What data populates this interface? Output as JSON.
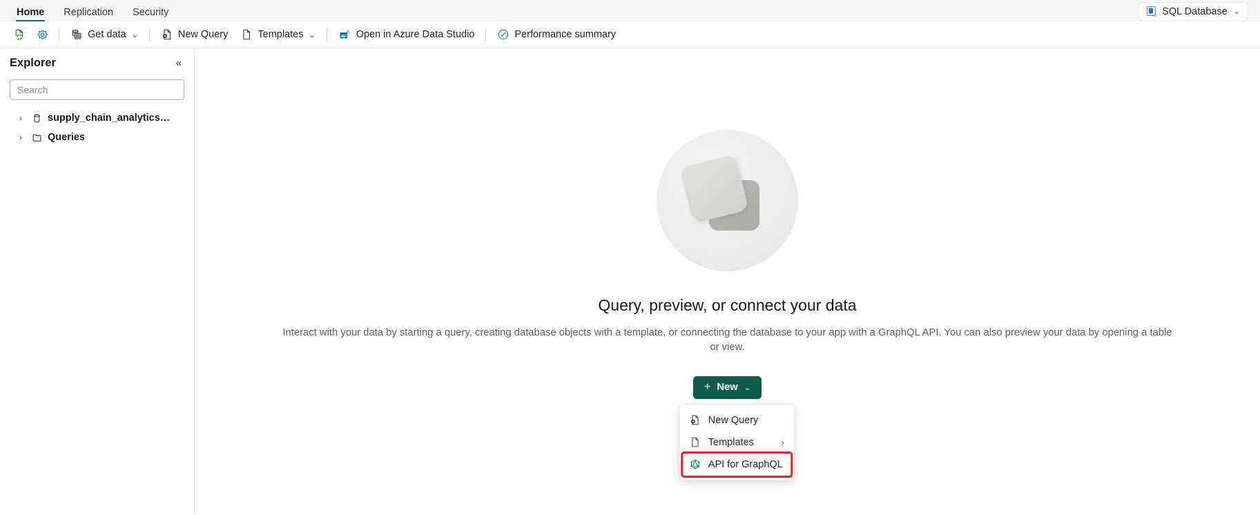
{
  "tabs": [
    {
      "label": "Home",
      "active": true
    },
    {
      "label": "Replication",
      "active": false
    },
    {
      "label": "Security",
      "active": false
    }
  ],
  "db_badge": {
    "label": "SQL Database",
    "icon": "sql-database-icon",
    "chevron": "⌄"
  },
  "toolbar": {
    "refresh_icon": "refresh-page-icon",
    "settings_icon": "gear-icon",
    "items": [
      {
        "label": "Get data",
        "icon": "database-table-icon",
        "chevron": "⌄"
      },
      {
        "label": "New Query",
        "icon": "new-query-icon",
        "chevron": ""
      },
      {
        "label": "Templates",
        "icon": "document-icon",
        "chevron": "⌄"
      },
      {
        "label": "Open in Azure Data Studio",
        "icon": "azure-data-studio-icon",
        "chevron": ""
      },
      {
        "label": "Performance summary",
        "icon": "performance-gauge-icon",
        "chevron": ""
      }
    ]
  },
  "sidebar": {
    "title": "Explorer",
    "collapse_icon": "«",
    "search": {
      "placeholder": "Search",
      "value": ""
    },
    "tree": [
      {
        "label": "supply_chain_analytics…",
        "icon": "database-icon",
        "arrow": "›"
      },
      {
        "label": "Queries",
        "icon": "folder-icon",
        "arrow": "›"
      }
    ]
  },
  "main": {
    "headline": "Query, preview, or connect your data",
    "description": "Interact with your data by starting a query, creating database objects with a template, or connecting the database to your app with a GraphQL API. You can also preview your data by opening a table or view.",
    "new_button": {
      "label": "New",
      "plus": "+",
      "chevron": "⌄"
    },
    "menu": [
      {
        "label": "New Query",
        "icon": "new-query-icon",
        "sub_chevron": "",
        "highlighted": false
      },
      {
        "label": "Templates",
        "icon": "document-icon",
        "sub_chevron": "›",
        "highlighted": false
      },
      {
        "label": "API for GraphQL",
        "icon": "graphql-icon",
        "sub_chevron": "",
        "highlighted": true
      }
    ]
  },
  "colors": {
    "accent_teal": "#0f6e5e",
    "button_green": "#0f5c4f",
    "highlight_red": "#ee1b20",
    "azure_blue": "#0f7cc4"
  }
}
